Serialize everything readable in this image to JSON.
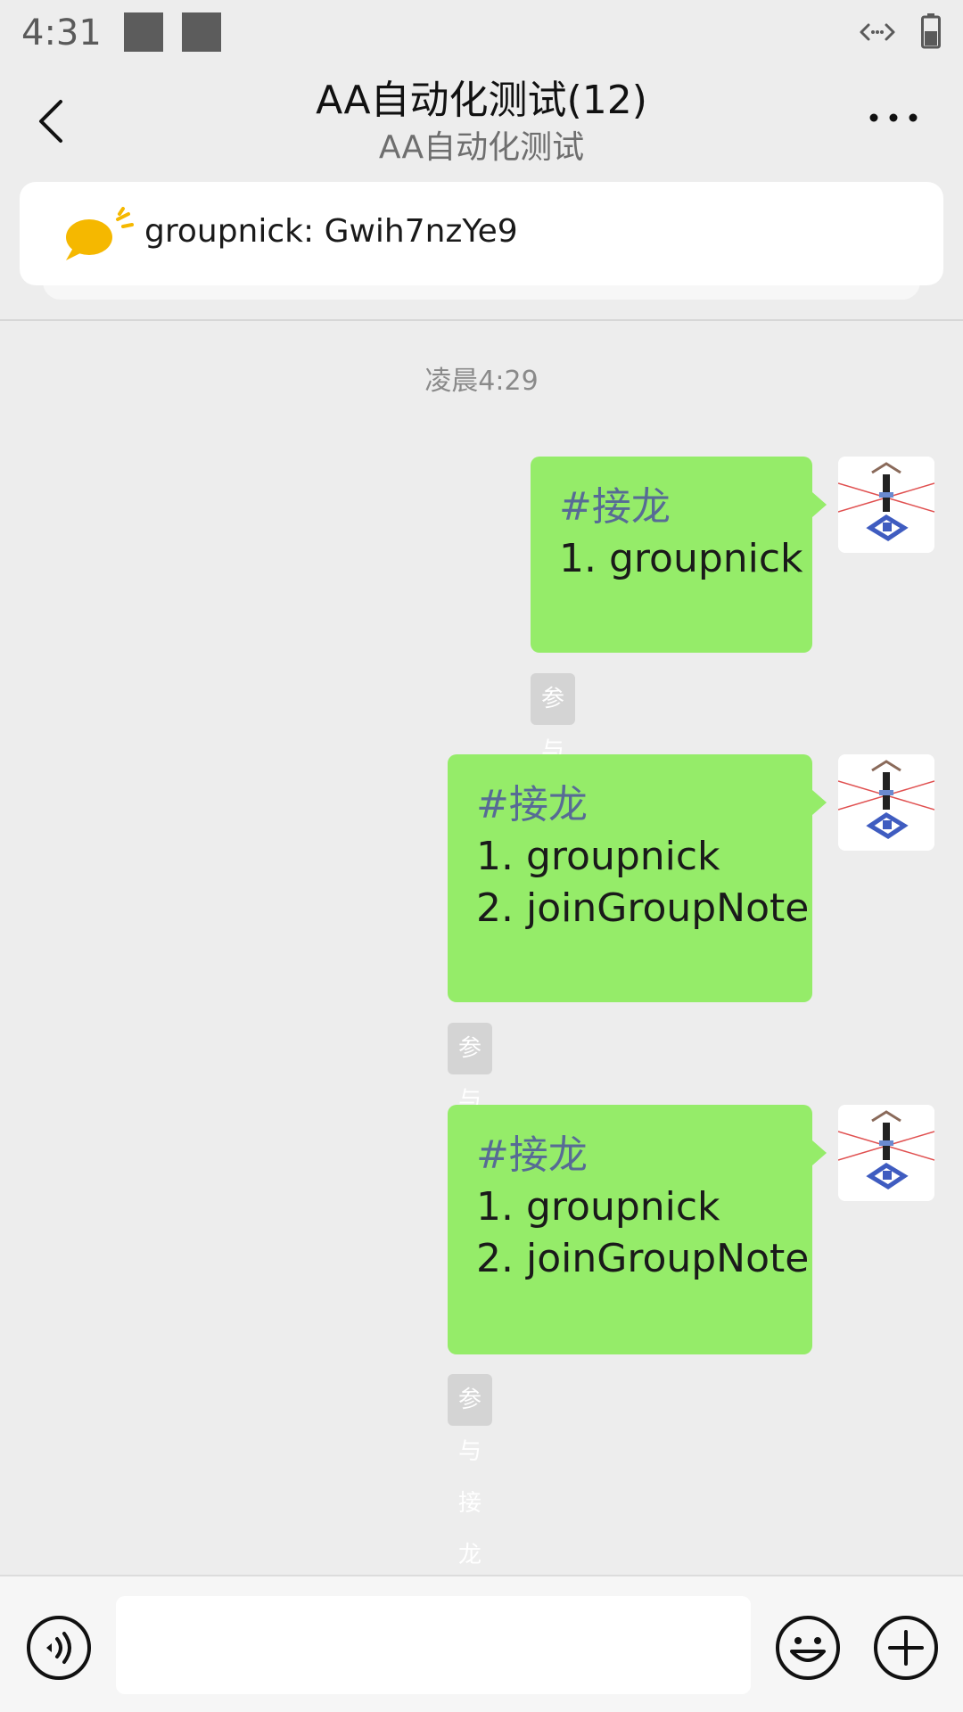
{
  "status_bar": {
    "time": "4:31"
  },
  "header": {
    "title": "AA自动化测试(12)",
    "subtitle": "AA自动化测试"
  },
  "notice": {
    "text": "groupnick: Gwih7nzYe9"
  },
  "chat": {
    "timestamp": "凌晨4:29",
    "messages": [
      {
        "tag": "#接龙",
        "lines": "\n1. groupnick",
        "join_label": "参与接龙"
      },
      {
        "tag": "#接龙",
        "lines": "\n1. groupnick\n2. joinGroupNote",
        "join_label": "参与接龙"
      },
      {
        "tag": "#接龙",
        "lines": "\n1. groupnick\n2. joinGroupNote",
        "join_label": "参与接龙"
      }
    ]
  },
  "input": {
    "placeholder": ""
  },
  "colors": {
    "background": "#ededed",
    "bubble": "#95ec69",
    "tag_link": "#576b95",
    "notice_icon": "#f5b800"
  },
  "icons": {
    "back": "chevron-left-icon",
    "more": "more-dots-icon",
    "notice": "speech-bubble-icon",
    "voice": "voice-icon",
    "emoji": "emoji-icon",
    "plus": "plus-circle-icon"
  }
}
